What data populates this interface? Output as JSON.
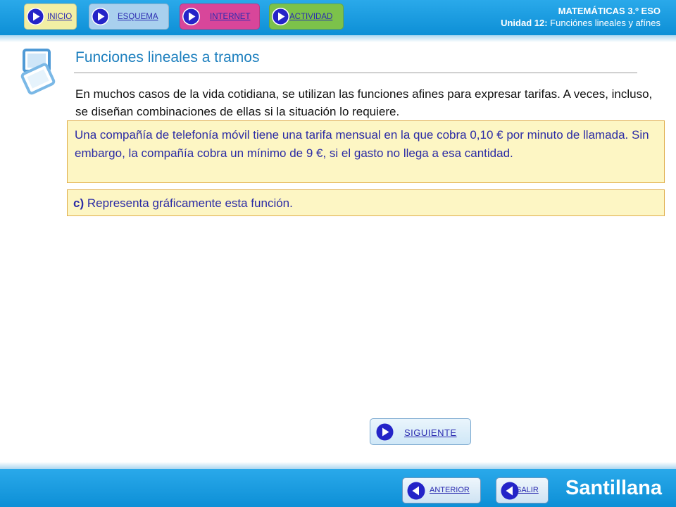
{
  "nav": {
    "inicio": "INICIO",
    "esquema": "ESQUEMA",
    "internet": "INTERNET",
    "actividad": "ACTIVIDAD"
  },
  "course": {
    "subject": "MATEMÁTICAS 3.º ESO",
    "unit_label": "Unidad 12:",
    "unit_title": " Funciónes lineales y afínes"
  },
  "page": {
    "title": "Funciones lineales a tramos",
    "intro": "En muchos casos de la vida cotidiana, se utilizan las funciones afines para expresar tarifas. A veces, incluso, se diseñan combinaciones de ellas si la situación lo requiere.",
    "problem": "Una compañía de telefonía móvil tiene una tarifa mensual en la que cobra 0,10 € por minuto de llamada. Sin embargo, la compañía cobra un mínimo de 9 €, si el gasto no llega a esa cantidad.",
    "question_letter": "c)",
    "question_text": " Representa gráficamente esta función."
  },
  "buttons": {
    "siguiente": "SIGUIENTE",
    "anterior": "ANTERIOR",
    "salir": "SALIR"
  },
  "brand": "Santillana",
  "icons": {
    "nav_play": "play-icon",
    "side": "document-stack-icon",
    "next": "play-icon",
    "back": "back-arrow-icon"
  },
  "colors": {
    "header_blue": "#1a9ee0",
    "title_blue": "#1c7fbe",
    "box_fill": "#fdf6c4",
    "box_border": "#e0ad4a",
    "box_text": "#2b2ba5",
    "inicio": "#f2efa4",
    "esquema": "#a9d0ee",
    "internet": "#d8469a",
    "actividad": "#7cc24a"
  }
}
